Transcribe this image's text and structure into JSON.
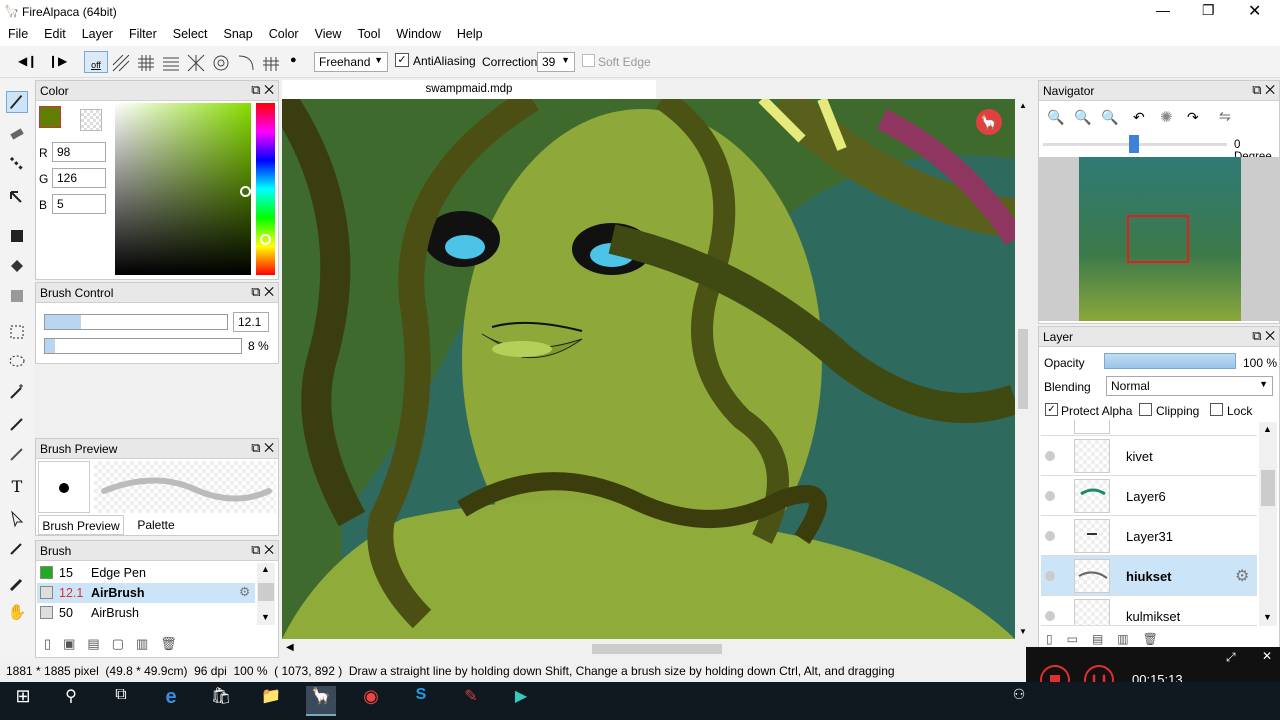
{
  "window": {
    "title": "FireAlpaca (64bit)"
  },
  "menu": [
    "File",
    "Edit",
    "Layer",
    "Filter",
    "Select",
    "Snap",
    "Color",
    "View",
    "Tool",
    "Window",
    "Help"
  ],
  "toolbar": {
    "snap_off": "off",
    "brush_mode": "Freehand",
    "antialiasing_label": "AntiAliasing",
    "antialiasing_checked": true,
    "correction_label": "Correction",
    "correction_value": "39",
    "soft_edge_label": "Soft Edge",
    "soft_edge_checked": false
  },
  "color_panel": {
    "title": "Color",
    "r_label": "R",
    "r": "98",
    "g_label": "G",
    "g": "126",
    "b_label": "B",
    "b": "5",
    "current_color": "#627e05"
  },
  "brush_control": {
    "title": "Brush Control",
    "size": "12.1",
    "size_fraction": 0.2,
    "opacity": "8 %",
    "opacity_fraction": 0.05
  },
  "brush_preview": {
    "title": "Brush Preview",
    "tab_preview": "Brush Preview",
    "tab_palette": "Palette"
  },
  "brush_panel": {
    "title": "Brush",
    "items": [
      {
        "size": "15",
        "name": "Edge Pen",
        "color": "#22aa22"
      },
      {
        "size": "12.1",
        "name": "AirBrush",
        "color": "#dddddd",
        "selected": true
      },
      {
        "size": "50",
        "name": "AirBrush",
        "color": "#dddddd"
      }
    ]
  },
  "canvas": {
    "tab": "swampmaid.mdp"
  },
  "navigator": {
    "title": "Navigator",
    "rotation": "0 Degree"
  },
  "layer_panel": {
    "title": "Layer",
    "opacity_label": "Opacity",
    "opacity": "100 %",
    "opacity_fraction": 1.0,
    "blending_label": "Blending",
    "blending": "Normal",
    "protect_alpha": "Protect Alpha",
    "protect_alpha_checked": true,
    "clipping": "Clipping",
    "clipping_checked": false,
    "lock": "Lock",
    "lock_checked": false,
    "layers": [
      {
        "name": "kivet"
      },
      {
        "name": "Layer6"
      },
      {
        "name": "Layer31"
      },
      {
        "name": "hiukset",
        "selected": true
      },
      {
        "name": "kulmikset"
      }
    ]
  },
  "status": {
    "text": "1881 * 1885 pixel  (49.8 * 49.9cm)  96 dpi  100 %  ( 1073, 892 )  Draw a straight line by holding down Shift, Change a brush size by holding down Ctrl, Alt, and dragging"
  },
  "recorder": {
    "time": "00:15:13"
  },
  "colors": {
    "accent": "#cce4f7",
    "selected_row": "#cce4f7",
    "brush_red": "#e03030"
  }
}
